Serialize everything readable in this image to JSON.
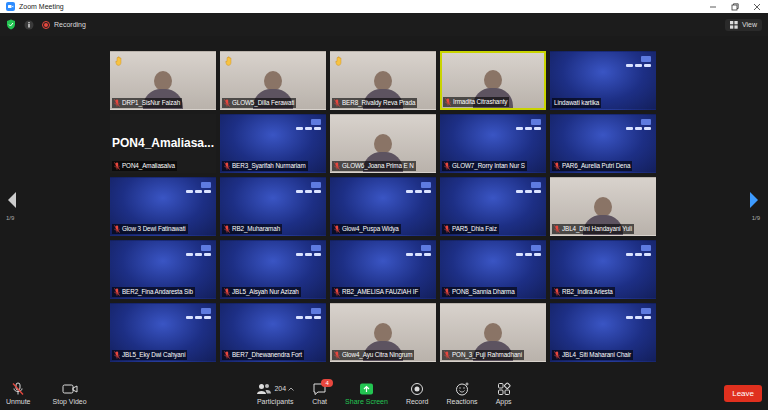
{
  "window": {
    "title": "Zoom Meeting"
  },
  "top_bar": {
    "recording": "Recording",
    "view": "View"
  },
  "pager": {
    "left": "1/9",
    "right": "1/9"
  },
  "tiles": [
    {
      "name": "DRP1_SisNur Faizah",
      "kind": "photo",
      "muted": true,
      "hand_raised": true,
      "speaking": false
    },
    {
      "name": "GLOW5_Dilla Ferawati",
      "kind": "photo",
      "muted": true,
      "hand_raised": true,
      "speaking": false
    },
    {
      "name": "BER8_Rivaldy Reva Prada",
      "kind": "photo",
      "muted": true,
      "hand_raised": true,
      "speaking": false
    },
    {
      "name": "Irmadita Citrashanty",
      "kind": "photo",
      "muted": true,
      "hand_raised": false,
      "speaking": true
    },
    {
      "name": "Lindawati kartika",
      "kind": "virtual",
      "muted": false,
      "hand_raised": false,
      "speaking": false
    },
    {
      "name": "PON4_Amaliasalva",
      "display_name": "PON4_Amaliasa...",
      "kind": "name-only",
      "muted": true,
      "hand_raised": false,
      "speaking": false
    },
    {
      "name": "BER3_Syarifah Nurmariam",
      "kind": "virtual",
      "muted": true,
      "hand_raised": false,
      "speaking": false
    },
    {
      "name": "GLOW6_Joana Prima E N",
      "kind": "photo",
      "muted": true,
      "hand_raised": false,
      "speaking": false
    },
    {
      "name": "GLOW7_Rorry Intan Nur S",
      "kind": "virtual",
      "muted": true,
      "hand_raised": false,
      "speaking": false
    },
    {
      "name": "PAR6_Aurelia Putri Dena",
      "kind": "virtual",
      "muted": true,
      "hand_raised": false,
      "speaking": false
    },
    {
      "name": "Glow 3 Dewi Fatinawati",
      "kind": "virtual",
      "muted": true,
      "hand_raised": false,
      "speaking": false
    },
    {
      "name": "RB2_Muharamah",
      "kind": "virtual",
      "muted": true,
      "hand_raised": false,
      "speaking": false
    },
    {
      "name": "Glow4_Puspa Widya",
      "kind": "virtual",
      "muted": true,
      "hand_raised": false,
      "speaking": false
    },
    {
      "name": "PAR5_Dhia Faiz",
      "kind": "virtual",
      "muted": true,
      "hand_raised": false,
      "speaking": false
    },
    {
      "name": "JBL4_Dini Handayani Yuli",
      "kind": "photo",
      "muted": true,
      "hand_raised": false,
      "speaking": false
    },
    {
      "name": "BER2_Fina Andaresta Sib",
      "kind": "virtual",
      "muted": true,
      "hand_raised": false,
      "speaking": false
    },
    {
      "name": "JBL5_Aisyah Nur Azizah",
      "kind": "virtual",
      "muted": true,
      "hand_raised": false,
      "speaking": false
    },
    {
      "name": "RB2_AMELISA FAUZIAH IF",
      "kind": "virtual",
      "muted": true,
      "hand_raised": false,
      "speaking": false
    },
    {
      "name": "PON8_Sannia Dharma",
      "kind": "virtual",
      "muted": true,
      "hand_raised": false,
      "speaking": false
    },
    {
      "name": "RB2_Indira Ariesta",
      "kind": "virtual",
      "muted": true,
      "hand_raised": false,
      "speaking": false
    },
    {
      "name": "JBL5_Eky Dwi Cahyani",
      "kind": "virtual",
      "muted": true,
      "hand_raised": false,
      "speaking": false
    },
    {
      "name": "BER7_Dhewanendra Fort",
      "kind": "virtual",
      "muted": true,
      "hand_raised": false,
      "speaking": false
    },
    {
      "name": "Glow4_Ayu Citra Ningrum",
      "kind": "photo",
      "muted": true,
      "hand_raised": false,
      "speaking": false
    },
    {
      "name": "PON_3_Puji Rahmadhani",
      "kind": "photo",
      "muted": true,
      "hand_raised": false,
      "speaking": false
    },
    {
      "name": "JBL4_Siti Maharani Chair",
      "kind": "virtual",
      "muted": true,
      "hand_raised": false,
      "speaking": false
    }
  ],
  "toolbar": {
    "items": [
      {
        "kind": "unmute",
        "label": "Unmute",
        "accent": false
      },
      {
        "kind": "video",
        "label": "Stop Video",
        "accent": false
      },
      {
        "kind": "participants",
        "label": "Participants",
        "count": "204",
        "accent": false
      },
      {
        "kind": "chat",
        "label": "Chat",
        "badge": "4",
        "accent": false
      },
      {
        "kind": "share",
        "label": "Share Screen",
        "accent": true
      },
      {
        "kind": "record",
        "label": "Record",
        "accent": false
      },
      {
        "kind": "reactions",
        "label": "Reactions",
        "accent": false
      },
      {
        "kind": "apps",
        "label": "Apps",
        "accent": false
      }
    ],
    "leave": "Leave"
  }
}
